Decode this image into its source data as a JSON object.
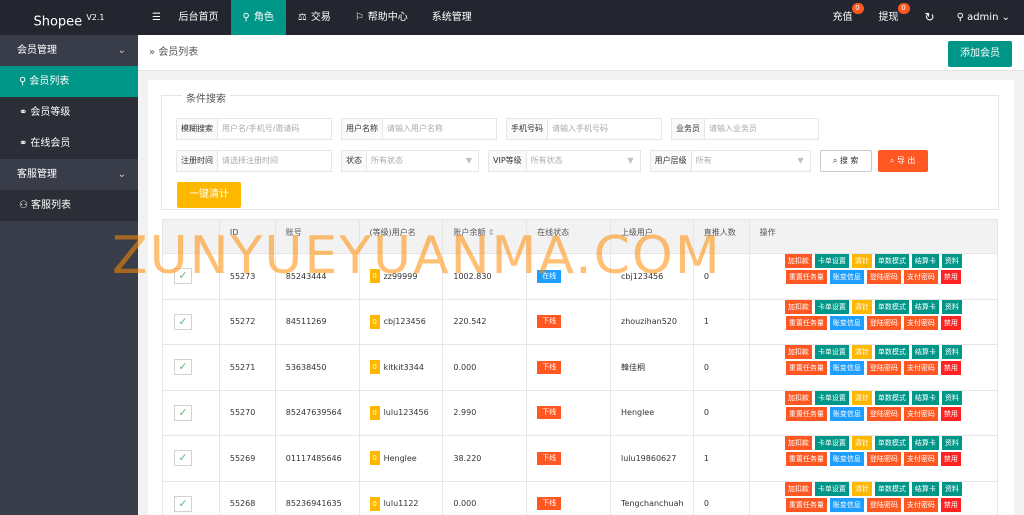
{
  "app": {
    "name": "Shopee",
    "version": "V2.1"
  },
  "nav": [
    {
      "label": "后台首页",
      "icon": "menu-icon"
    },
    {
      "label": "角色",
      "icon": "user-icon"
    },
    {
      "label": "交易",
      "icon": "scale-icon"
    },
    {
      "label": "帮助中心",
      "icon": "flag-icon"
    },
    {
      "label": "系统管理",
      "icon": ""
    }
  ],
  "top_right": {
    "recharge": "充值",
    "recharge_badge": "0",
    "withdraw": "提现",
    "withdraw_badge": "0",
    "user": "admin"
  },
  "sidebar": {
    "group1": "会员管理",
    "items1": [
      "会员列表",
      "会员等级",
      "在线会员"
    ],
    "group2": "客服管理",
    "items2": [
      "客服列表"
    ]
  },
  "breadcrumb": "会员列表",
  "add_button": "添加会员",
  "search": {
    "legend": "条件搜索",
    "fuzzy_label": "模糊搜索",
    "fuzzy_placeholder": "用户名/手机号/邀请码",
    "username_label": "用户名称",
    "username_placeholder": "请输入用户名称",
    "phone_label": "手机号码",
    "phone_placeholder": "请输入手机号码",
    "agent_label": "业务员",
    "agent_placeholder": "请输入业务员",
    "regtime_label": "注册时间",
    "regtime_placeholder": "请选择注册时间",
    "status_label": "状态",
    "status_value": "所有状态",
    "vip_label": "VIP等级",
    "vip_value": "所有状态",
    "level_label": "用户层级",
    "level_value": "所有",
    "search_button": "搜 索",
    "export_button": "导 出",
    "count_button": "一键清计"
  },
  "watermark": "ZUNYUEYUANMA.COM",
  "table": {
    "headers": [
      "",
      "ID",
      "账号",
      "(等级)用户名",
      "账户余额",
      "在线状态",
      "上级用户",
      "直推人数",
      "操作"
    ],
    "ops_row1": [
      "加扣款",
      "卡单设置",
      "清针",
      "单数模式",
      "结算卡",
      "资料"
    ],
    "ops_row2": [
      "重置任务量",
      "账变信息",
      "登陆密码",
      "支付密码",
      "禁用"
    ],
    "rows": [
      {
        "id": "55273",
        "account": "85243444",
        "level": "0",
        "username": "zz99999",
        "balance": "1002.830",
        "status": "在线",
        "online": true,
        "parent": "cbj123456",
        "direct": "0"
      },
      {
        "id": "55272",
        "account": "84511269",
        "level": "0",
        "username": "cbj123456",
        "balance": "220.542",
        "status": "下线",
        "online": false,
        "parent": "zhouzihan520",
        "direct": "1"
      },
      {
        "id": "55271",
        "account": "53638450",
        "level": "0",
        "username": "kitkit3344",
        "balance": "0.000",
        "status": "下线",
        "online": false,
        "parent": "韓佳桐",
        "direct": "0"
      },
      {
        "id": "55270",
        "account": "85247639564",
        "level": "0",
        "username": "lulu123456",
        "balance": "2.990",
        "status": "下线",
        "online": false,
        "parent": "Henglee",
        "direct": "0"
      },
      {
        "id": "55269",
        "account": "01117485646",
        "level": "0",
        "username": "Henglee",
        "balance": "38.220",
        "status": "下线",
        "online": false,
        "parent": "lulu19860627",
        "direct": "1"
      },
      {
        "id": "55268",
        "account": "85236941635",
        "level": "0",
        "username": "lulu1122",
        "balance": "0.000",
        "status": "下线",
        "online": false,
        "parent": "Tengchanchuah",
        "direct": "0"
      }
    ]
  },
  "colors": {
    "accent": "#009688",
    "header_bg": "#23262e",
    "sidebar_bg": "#393d49",
    "danger": "#ff5722",
    "warn": "#ffb800",
    "info": "#1e9fff"
  }
}
